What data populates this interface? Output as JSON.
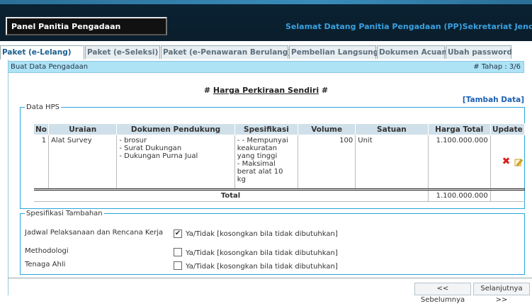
{
  "header": {
    "brand": "Panel Panitia Pengadaan",
    "welcome": "Selamat Datang Panitia Pengadaan (PP)Sekretariat Jendera"
  },
  "tabs": [
    {
      "label": "Paket (e-Lelang)",
      "active": true
    },
    {
      "label": "Paket (e-Seleksi)"
    },
    {
      "label": "Paket (e-Penawaran Berulang)"
    },
    {
      "label": "Pembelian Langsung"
    },
    {
      "label": "Dokumen Acuan"
    },
    {
      "label": "Ubah password"
    }
  ],
  "crumb": {
    "left": "Buat Data Pengadaan",
    "right": "# Tahap : 3/6"
  },
  "page": {
    "title_prefix": "# ",
    "title_main": "Harga Perkiraan Sendiri",
    "title_suffix": " #",
    "add_link": "[Tambah Data]"
  },
  "hps": {
    "legend": "Data HPS",
    "columns": [
      "No",
      "Uraian",
      "Dokumen Pendukung",
      "Spesifikasi",
      "Volume",
      "Satuan",
      "Harga Total",
      "Update"
    ],
    "rows": [
      {
        "no": "1",
        "uraian": "Alat Survey",
        "dokumen": [
          "- brosur",
          "- Surat Dukungan",
          "- Dukungan Purna Jual"
        ],
        "spesifikasi": [
          "- - Mempunyai",
          "keakuratan",
          "yang tinggi",
          "- Maksimal",
          "berat alat 10",
          "kg"
        ],
        "volume": "100",
        "satuan": "Unit",
        "harga_total": "1.100.000.000"
      }
    ],
    "total_label": "Total",
    "total_value": "1.100.000.000"
  },
  "spesifikasi_tambahan": {
    "legend": "Spesifikasi Tambahan",
    "items": [
      {
        "label": "Jadwal Pelaksanaan dan Rencana Kerja",
        "checked": true,
        "text": "Ya/Tidak [kosongkan bila tidak dibutuhkan]"
      },
      {
        "label": "Methodologi",
        "checked": false,
        "text": "Ya/Tidak [kosongkan bila tidak dibutuhkan]"
      },
      {
        "label": "Tenaga Ahli",
        "checked": false,
        "text": "Ya/Tidak [kosongkan bila tidak dibutuhkan]"
      }
    ]
  },
  "nav": {
    "prev": "<< Sebelumnya",
    "next": "Selanjutnya >>"
  },
  "colors": {
    "accent_blue": "#2aa6d8",
    "crumb_bg": "#aee3f6",
    "header_dark": "#0a1e2c",
    "delete_red": "#d81d1d"
  },
  "icons": {
    "delete": "delete-x-icon",
    "edit": "edit-pencil-icon",
    "check": "checkbox-icon"
  }
}
